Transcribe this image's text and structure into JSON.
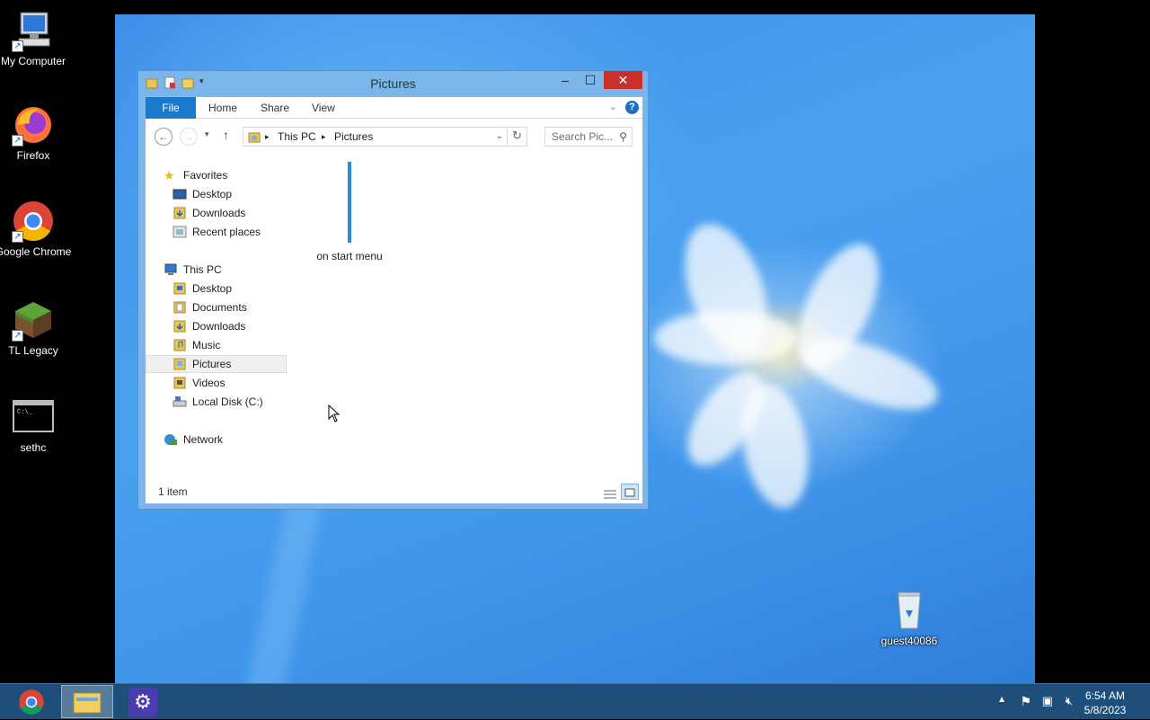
{
  "desktop": {
    "icons": [
      {
        "label": "My Computer"
      },
      {
        "label": "Firefox"
      },
      {
        "label": "Google Chrome"
      },
      {
        "label": "TL Legacy"
      },
      {
        "label": "sethc"
      },
      {
        "label": "guest40086"
      }
    ]
  },
  "window": {
    "title": "Pictures",
    "minimize": "–",
    "maximize": "☐",
    "close": "✕",
    "ribbon_tabs": [
      "File",
      "Home",
      "Share",
      "View"
    ],
    "help": "?",
    "address": {
      "root": "This PC",
      "current": "Pictures"
    },
    "search_placeholder": "Search Pic...",
    "nav": {
      "favorites": "Favorites",
      "fav_items": [
        "Desktop",
        "Downloads",
        "Recent places"
      ],
      "this_pc": "This PC",
      "pc_items": [
        "Desktop",
        "Documents",
        "Downloads",
        "Music",
        "Pictures",
        "Videos",
        "Local Disk (C:)"
      ],
      "network": "Network"
    },
    "files": [
      {
        "name": "on start menu"
      }
    ],
    "status": "1 item"
  },
  "taskbar": {
    "time": "6:54 AM",
    "date": "5/8/2023"
  }
}
